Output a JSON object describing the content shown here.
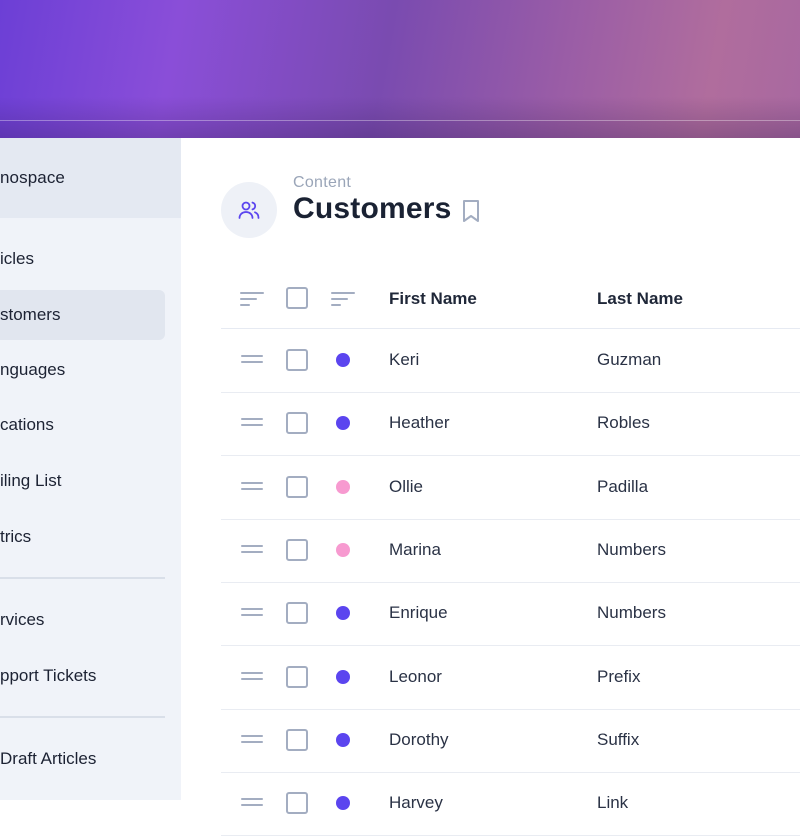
{
  "sidebar": {
    "project_name": "nospace",
    "items": [
      {
        "label": "icles",
        "active": false
      },
      {
        "label": "stomers",
        "active": true
      },
      {
        "label": "nguages",
        "active": false
      },
      {
        "label": "cations",
        "active": false
      },
      {
        "label": "iling List",
        "active": false
      },
      {
        "label": "trics",
        "active": false
      },
      {
        "label": "rvices",
        "active": false
      },
      {
        "label": "pport Tickets",
        "active": false
      },
      {
        "label": " Draft Articles",
        "active": false
      }
    ]
  },
  "header": {
    "subtitle": "Content",
    "title": "Customers",
    "icon": "users-icon",
    "bookmark_icon": "bookmark-icon"
  },
  "table": {
    "columns": [
      "First Name",
      "Last Name"
    ],
    "rows": [
      {
        "first": "Keri",
        "last": "Guzman",
        "status_color": "#5b45ef"
      },
      {
        "first": "Heather",
        "last": "Robles",
        "status_color": "#5b45ef"
      },
      {
        "first": "Ollie",
        "last": "Padilla",
        "status_color": "#f79ad0"
      },
      {
        "first": "Marina",
        "last": "Numbers",
        "status_color": "#f79ad0"
      },
      {
        "first": "Enrique",
        "last": "Numbers",
        "status_color": "#5b45ef"
      },
      {
        "first": "Leonor",
        "last": "Prefix",
        "status_color": "#5b45ef"
      },
      {
        "first": "Dorothy",
        "last": "Suffix",
        "status_color": "#5b45ef"
      },
      {
        "first": "Harvey",
        "last": "Link",
        "status_color": "#5b45ef"
      }
    ]
  },
  "colors": {
    "accent": "#5b45ef",
    "pink_status": "#f79ad0",
    "sidebar_bg": "#f0f3f9"
  }
}
